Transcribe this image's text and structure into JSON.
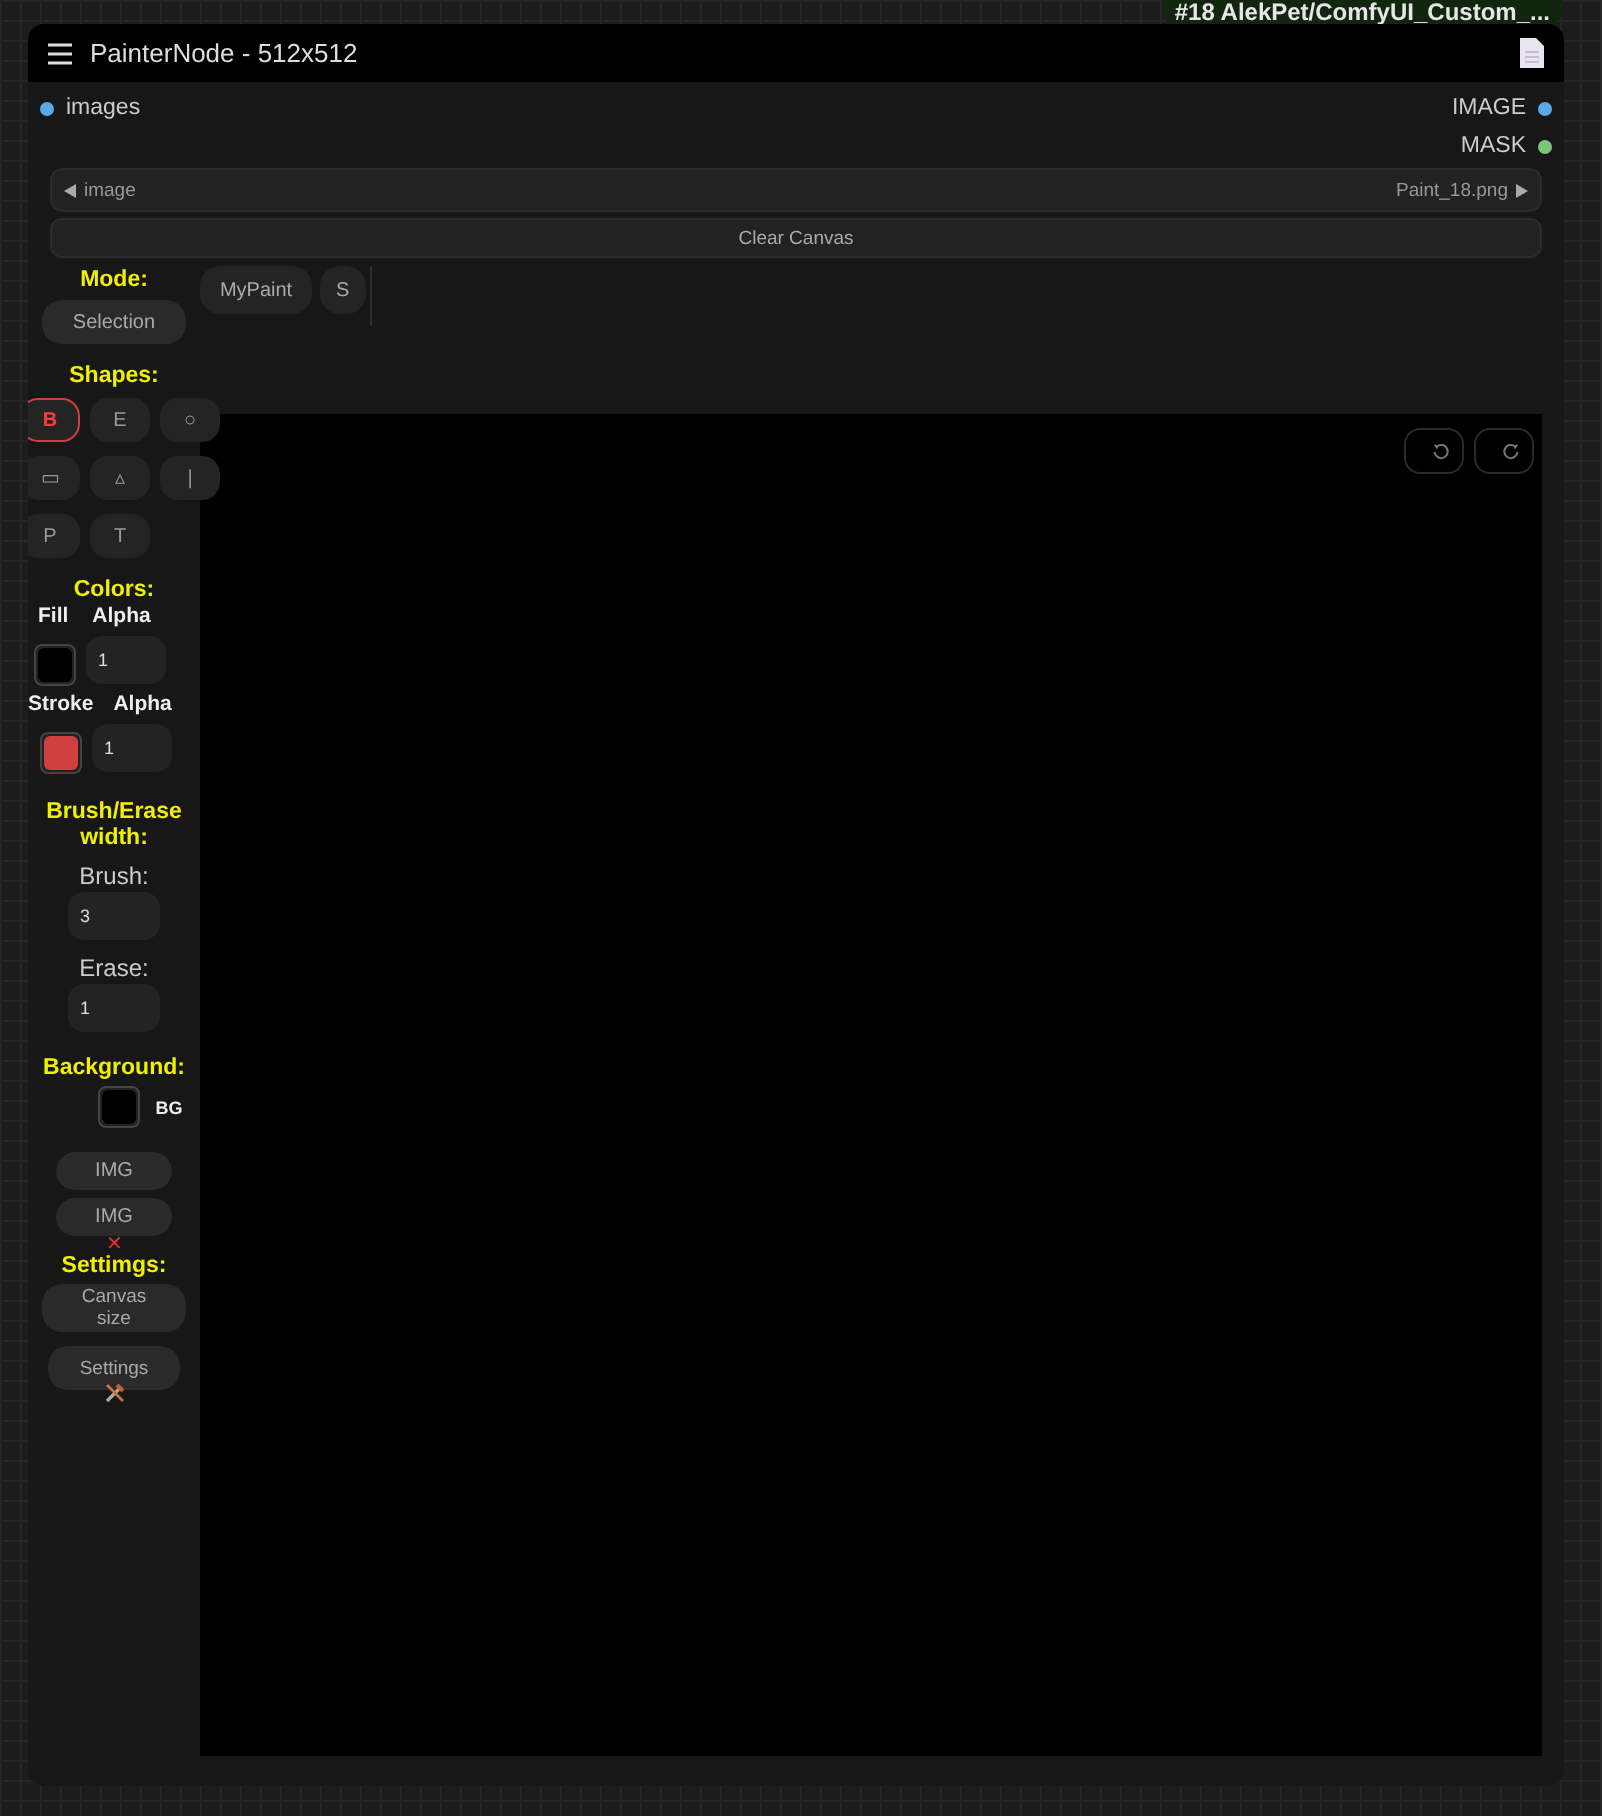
{
  "tag": "#18 AlekPet/ComfyUI_Custom_...",
  "node": {
    "title": "PainterNode - 512x512"
  },
  "inputs": [
    {
      "label": "images",
      "color": "#5aa9e6"
    }
  ],
  "outputs": [
    {
      "label": "IMAGE",
      "color": "#5aa9e6"
    },
    {
      "label": "MASK",
      "color": "#7ac77a"
    }
  ],
  "image_combo": {
    "label": "image",
    "value": "Paint_18.png"
  },
  "clear_button": "Clear Canvas",
  "mode": {
    "title": "Mode:",
    "button": "Selection"
  },
  "mode_tabs": [
    {
      "label": "MyPaint",
      "selected": false
    },
    {
      "label": "S",
      "selected": false
    }
  ],
  "shapes": {
    "title": "Shapes:",
    "items": [
      {
        "label": "B",
        "selected": true
      },
      {
        "label": "E",
        "selected": false
      },
      {
        "label": "○",
        "selected": false
      },
      {
        "label": "▭",
        "selected": false
      },
      {
        "label": "▵",
        "selected": false
      },
      {
        "label": "|",
        "selected": false
      },
      {
        "label": "P",
        "selected": false
      },
      {
        "label": "T",
        "selected": false
      }
    ]
  },
  "colors": {
    "title": "Colors:",
    "rows": [
      {
        "label": "Fill",
        "alpha_label": "Alpha",
        "color": "#000000",
        "alpha": "1"
      },
      {
        "label": "Stroke",
        "alpha_label": "Alpha",
        "color": "#d04040",
        "alpha": "1"
      }
    ]
  },
  "widths": {
    "title": "Brush/Erase width:",
    "fields": [
      {
        "label": "Brush:",
        "value": "3"
      },
      {
        "label": "Erase:",
        "value": "1"
      }
    ]
  },
  "background": {
    "title": "Background:",
    "color": "#000000",
    "label": "BG"
  },
  "image_buttons": [
    {
      "label": "IMG"
    },
    {
      "label": "IMG",
      "suffix": "✕"
    }
  ],
  "settings": {
    "title": "Settimgs:",
    "buttons": [
      {
        "kind": "text",
        "label": "Canvas size"
      },
      {
        "kind": "tools",
        "label": "Settings"
      }
    ]
  }
}
